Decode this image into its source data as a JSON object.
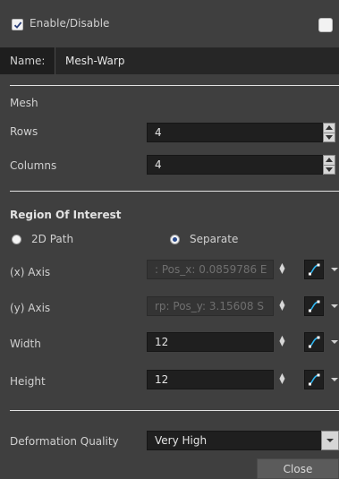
{
  "header": {
    "enable_label": "Enable/Disable",
    "enable_checked": true
  },
  "name_row": {
    "label": "Name:",
    "value": "Mesh-Warp"
  },
  "mesh": {
    "section_label": "Mesh",
    "rows_label": "Rows",
    "rows_value": "4",
    "columns_label": "Columns",
    "columns_value": "4"
  },
  "roi": {
    "section_label": "Region Of Interest",
    "radio_2d_path": "2D Path",
    "radio_separate": "Separate",
    "selected": "Separate",
    "x_axis_label": "(x) Axis",
    "x_axis_value": ": Pos_x: 0.0859786 E",
    "y_axis_label": "(y) Axis",
    "y_axis_value": "rp: Pos_y: 3.15608 S",
    "width_label": "Width",
    "width_value": "12",
    "height_label": "Height",
    "height_value": "12"
  },
  "deformation": {
    "label": "Deformation Quality",
    "value": "Very High"
  },
  "footer": {
    "close_label": "Close"
  },
  "icons": [
    "checkbox-checked",
    "spin-arrows",
    "function-curve-icon",
    "caret-down-icon",
    "radio-button"
  ],
  "colors": {
    "panel_bg": "#3f3f3f",
    "field_bg": "#1f1f1f",
    "divider": "#e2e2e2",
    "function_icon": "#2fb6f0"
  }
}
